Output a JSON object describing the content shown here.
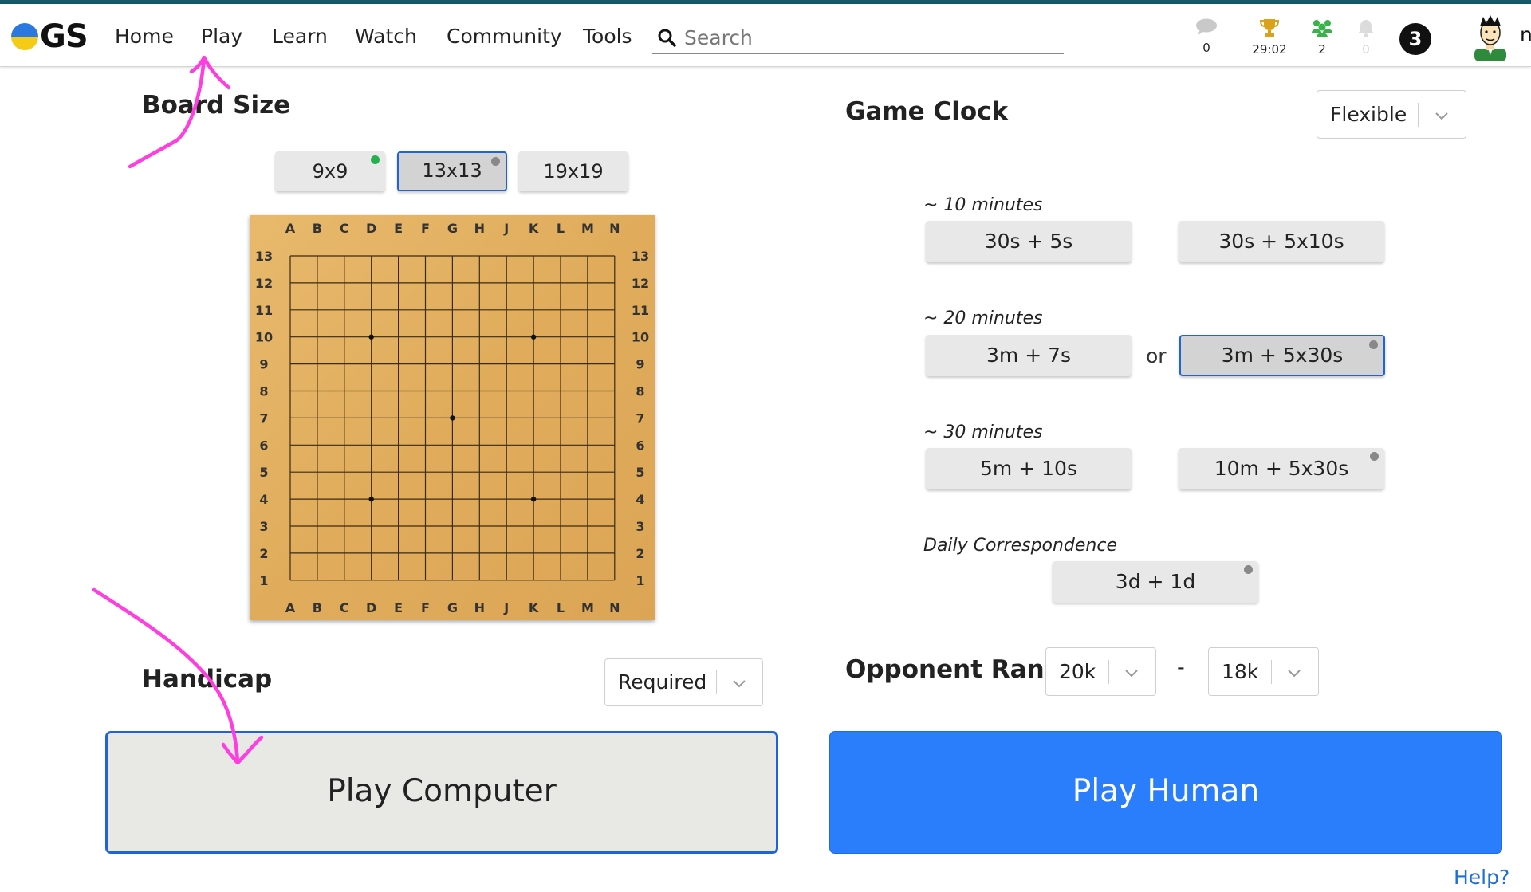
{
  "app": {
    "logo_text": "GS"
  },
  "nav": {
    "items": [
      {
        "label": "Home"
      },
      {
        "label": "Play"
      },
      {
        "label": "Learn"
      },
      {
        "label": "Watch"
      },
      {
        "label": "Community"
      },
      {
        "label": "Tools"
      }
    ],
    "search_placeholder": "Search",
    "indicators": [
      {
        "icon": "chat-bubble-icon",
        "value": "0"
      },
      {
        "icon": "trophy-icon",
        "value": "29:02"
      },
      {
        "icon": "friends-icon",
        "value": "2"
      },
      {
        "icon": "bell-icon",
        "value": "0"
      }
    ],
    "notification_count": "3",
    "user_initial": "n"
  },
  "board_size": {
    "title": "Board Size",
    "options": [
      {
        "label": "9x9",
        "selected": false,
        "dot": "green"
      },
      {
        "label": "13x13",
        "selected": true,
        "dot": "gray"
      },
      {
        "label": "19x19",
        "selected": false,
        "dot": "none"
      }
    ]
  },
  "board": {
    "columns": [
      "A",
      "B",
      "C",
      "D",
      "E",
      "F",
      "G",
      "H",
      "J",
      "K",
      "L",
      "M",
      "N"
    ],
    "rows": [
      "13",
      "12",
      "11",
      "10",
      "9",
      "8",
      "7",
      "6",
      "5",
      "4",
      "3",
      "2",
      "1"
    ],
    "star_points": [
      [
        "D",
        "10"
      ],
      [
        "K",
        "10"
      ],
      [
        "G",
        "7"
      ],
      [
        "D",
        "4"
      ],
      [
        "K",
        "4"
      ]
    ]
  },
  "handicap": {
    "title": "Handicap",
    "value": "Required"
  },
  "game_clock": {
    "title": "Game Clock",
    "mode": "Flexible",
    "groups": [
      {
        "label": "~ 10 minutes",
        "options": [
          {
            "label": "30s + 5s",
            "selected": false
          },
          {
            "label": "30s + 5x10s",
            "selected": false
          }
        ]
      },
      {
        "label": "~ 20 minutes",
        "options": [
          {
            "label": "3m + 7s",
            "selected": false
          },
          {
            "label": "3m + 5x30s",
            "selected": true
          }
        ]
      },
      {
        "label": "~ 30 minutes",
        "options": [
          {
            "label": "5m + 10s",
            "selected": false
          },
          {
            "label": "10m + 5x30s",
            "selected": false
          }
        ]
      },
      {
        "label": "Daily Correspondence",
        "options": [
          {
            "label": "3d + 1d",
            "selected": false
          }
        ]
      }
    ],
    "or_text": "or"
  },
  "opponent_rank": {
    "title": "Opponent Rank",
    "min": "20k",
    "separator": "-",
    "max": "18k"
  },
  "actions": {
    "play_computer": "Play Computer",
    "play_human": "Play Human",
    "help": "Help?"
  },
  "colors": {
    "accent": "#1e63d8",
    "play_human_bg": "#2a7efb",
    "board_wood": "#e3b064",
    "annotation": "#ff3ee0"
  }
}
